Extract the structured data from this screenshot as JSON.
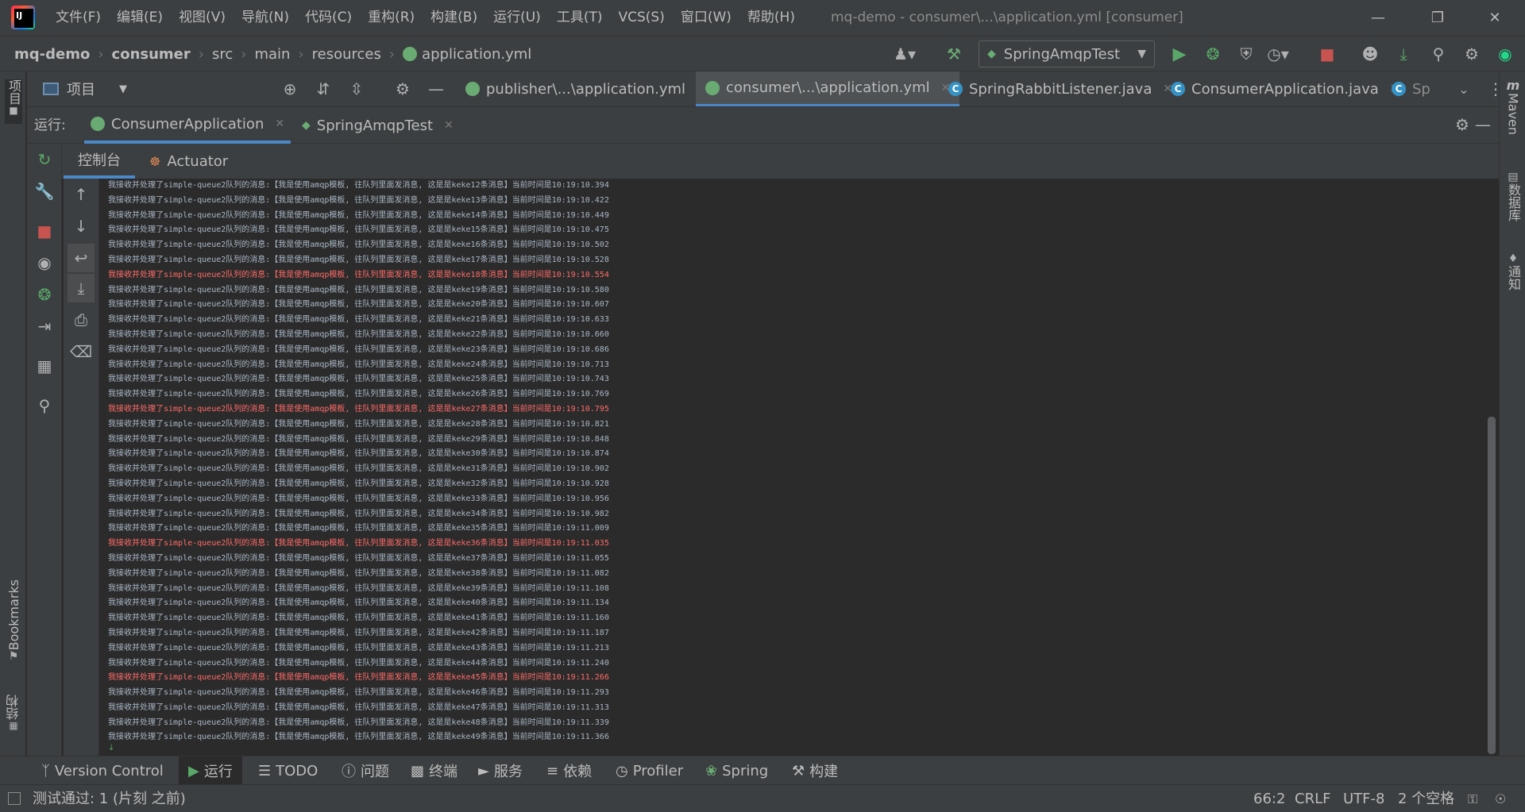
{
  "app": {
    "menu": [
      "文件(F)",
      "编辑(E)",
      "视图(V)",
      "导航(N)",
      "代码(C)",
      "重构(R)",
      "构建(B)",
      "运行(U)",
      "工具(T)",
      "VCS(S)",
      "窗口(W)",
      "帮助(H)"
    ],
    "window_title": "mq-demo - consumer\\...\\application.yml [consumer]"
  },
  "breadcrumb": [
    "mq-demo",
    "consumer",
    "src",
    "main",
    "resources",
    "application.yml"
  ],
  "run_config": "SpringAmqpTest",
  "left_stripe": {
    "project": "项目",
    "bookmarks": "Bookmarks",
    "structure": "结构"
  },
  "right_stripe": {
    "maven": "Maven",
    "database": "数据库",
    "notifications": "通知"
  },
  "project_button": "项目",
  "editor_tabs": [
    {
      "label": "publisher\\...\\application.yml",
      "active": false
    },
    {
      "label": "consumer\\...\\application.yml",
      "active": true
    },
    {
      "label": "SpringRabbitListener.java",
      "active": false
    },
    {
      "label": "ConsumerApplication.java",
      "active": false
    },
    {
      "label": "Sp",
      "active": false
    }
  ],
  "run_panel": {
    "label": "运行:",
    "tabs": [
      {
        "label": "ConsumerApplication",
        "active": true
      },
      {
        "label": "SpringAmqpTest",
        "active": false
      }
    ],
    "sub_tabs": [
      {
        "label": "控制台",
        "active": true
      },
      {
        "label": "Actuator",
        "active": false
      }
    ]
  },
  "console": {
    "prefix": "我接收并处理了simple-queue2队列的消息:【我是使用amqp模板, 往队列里面发消息, 这是是keke",
    "suffix": "条消息】当前时间是",
    "lines": [
      {
        "n": "12",
        "time": "10:19:10.394",
        "red": false
      },
      {
        "n": "13",
        "time": "10:19:10.422",
        "red": false
      },
      {
        "n": "14",
        "time": "10:19:10.449",
        "red": false
      },
      {
        "n": "15",
        "time": "10:19:10.475",
        "red": false
      },
      {
        "n": "16",
        "time": "10:19:10.502",
        "red": false
      },
      {
        "n": "17",
        "time": "10:19:10.528",
        "red": false
      },
      {
        "n": "18",
        "time": "10:19:10.554",
        "red": true
      },
      {
        "n": "19",
        "time": "10:19:10.580",
        "red": false
      },
      {
        "n": "20",
        "time": "10:19:10.607",
        "red": false
      },
      {
        "n": "21",
        "time": "10:19:10.633",
        "red": false
      },
      {
        "n": "22",
        "time": "10:19:10.660",
        "red": false
      },
      {
        "n": "23",
        "time": "10:19:10.686",
        "red": false
      },
      {
        "n": "24",
        "time": "10:19:10.713",
        "red": false
      },
      {
        "n": "25",
        "time": "10:19:10.743",
        "red": false
      },
      {
        "n": "26",
        "time": "10:19:10.769",
        "red": false
      },
      {
        "n": "27",
        "time": "10:19:10.795",
        "red": true
      },
      {
        "n": "28",
        "time": "10:19:10.821",
        "red": false
      },
      {
        "n": "29",
        "time": "10:19:10.848",
        "red": false
      },
      {
        "n": "30",
        "time": "10:19:10.874",
        "red": false
      },
      {
        "n": "31",
        "time": "10:19:10.902",
        "red": false
      },
      {
        "n": "32",
        "time": "10:19:10.928",
        "red": false
      },
      {
        "n": "33",
        "time": "10:19:10.956",
        "red": false
      },
      {
        "n": "34",
        "time": "10:19:10.982",
        "red": false
      },
      {
        "n": "35",
        "time": "10:19:11.009",
        "red": false
      },
      {
        "n": "36",
        "time": "10:19:11.035",
        "red": true
      },
      {
        "n": "37",
        "time": "10:19:11.055",
        "red": false
      },
      {
        "n": "38",
        "time": "10:19:11.082",
        "red": false
      },
      {
        "n": "39",
        "time": "10:19:11.108",
        "red": false
      },
      {
        "n": "40",
        "time": "10:19:11.134",
        "red": false
      },
      {
        "n": "41",
        "time": "10:19:11.160",
        "red": false
      },
      {
        "n": "42",
        "time": "10:19:11.187",
        "red": false
      },
      {
        "n": "43",
        "time": "10:19:11.213",
        "red": false
      },
      {
        "n": "44",
        "time": "10:19:11.240",
        "red": false
      },
      {
        "n": "45",
        "time": "10:19:11.266",
        "red": true
      },
      {
        "n": "46",
        "time": "10:19:11.293",
        "red": false
      },
      {
        "n": "47",
        "time": "10:19:11.313",
        "red": false
      },
      {
        "n": "48",
        "time": "10:19:11.339",
        "red": false
      },
      {
        "n": "49",
        "time": "10:19:11.366",
        "red": false
      }
    ]
  },
  "bottom_tools": [
    "Version Control",
    "运行",
    "TODO",
    "问题",
    "终端",
    "服务",
    "依赖",
    "Profiler",
    "Spring",
    "构建"
  ],
  "status": {
    "message": "测试通过: 1 (片刻 之前)",
    "position": "66:2",
    "line_sep": "CRLF",
    "encoding": "UTF-8",
    "indent": "2 个空格"
  }
}
